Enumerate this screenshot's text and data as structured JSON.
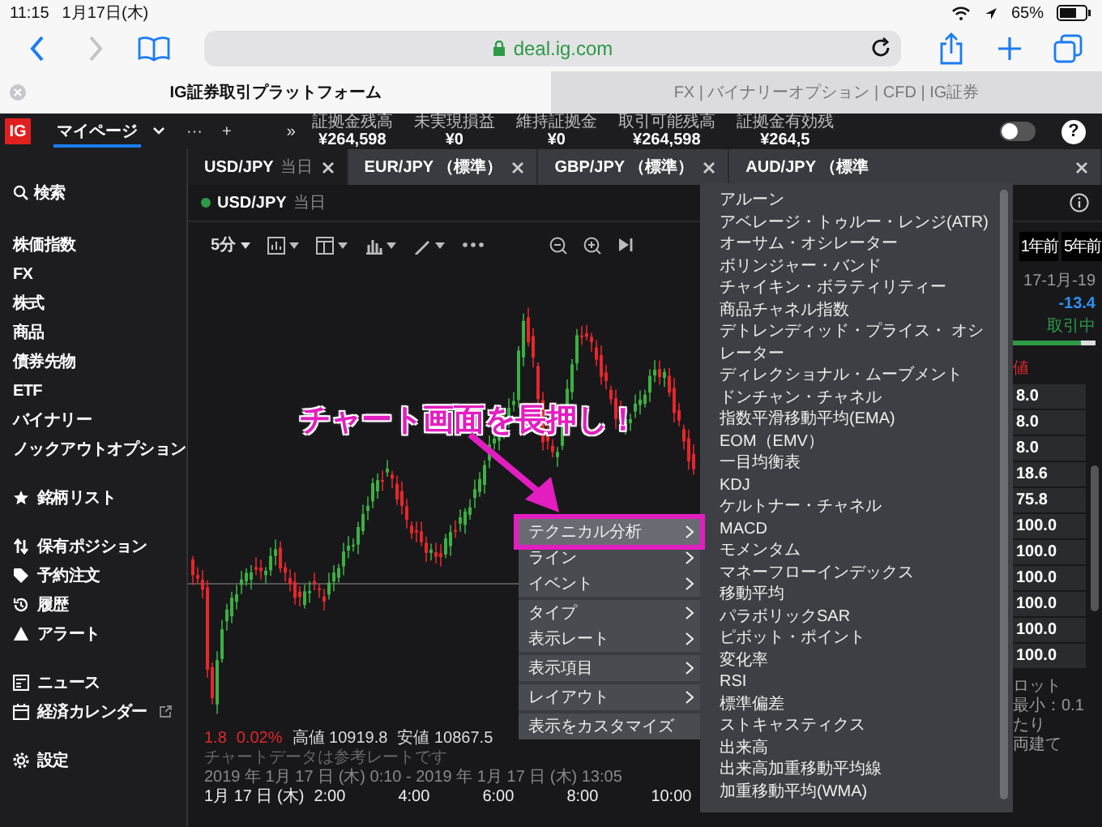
{
  "status_bar": {
    "time": "11:15",
    "date": "1月17日(木)",
    "battery": "65%"
  },
  "browser": {
    "url": "deal.ig.com",
    "tabs": [
      {
        "title": "IG証券取引プラットフォーム",
        "selected": true
      },
      {
        "title": "FX | バイナリーオプション | CFD | IG証券",
        "selected": false
      }
    ]
  },
  "app_header": {
    "logo": "IG",
    "page": "マイページ",
    "more": "···",
    "add": "+",
    "expand": "»",
    "stats": [
      {
        "label": "証拠金残高",
        "value": "¥264,598"
      },
      {
        "label": "未実現損益",
        "value": "¥0"
      },
      {
        "label": "維持証拠金",
        "value": "¥0"
      },
      {
        "label": "取引可能残高",
        "value": "¥264,598"
      },
      {
        "label": "証拠金有効残",
        "value": "¥264,5"
      }
    ],
    "toggle": {
      "on": false
    },
    "help": "?"
  },
  "sidebar": {
    "search": "検索",
    "groups": [
      [
        "株価指数",
        "FX",
        "株式",
        "商品",
        "債券先物",
        "ETF",
        "バイナリー",
        "ノックアウトオプション"
      ],
      [
        "銘柄リスト"
      ],
      [
        "保有ポジション",
        "予約注文",
        "履歴",
        "アラート"
      ],
      [
        "ニュース",
        "経済カレンダー"
      ],
      [
        "設定"
      ]
    ]
  },
  "market_tabs": [
    {
      "label": "USD/JPY",
      "period": "当日",
      "selected": true
    },
    {
      "label": "EUR/JPY （標準）",
      "selected": false
    },
    {
      "label": "GBP/JPY （標準）",
      "selected": false
    },
    {
      "label": "AUD/JPY （標準",
      "selected": false
    }
  ],
  "chart": {
    "title": "USD/JPY",
    "period": "当日",
    "open": true,
    "interval": "5分",
    "annotation": "チャート画面を長押し！",
    "change": "1.8",
    "change_pct": "0.02%",
    "high": "高値 10919.8",
    "low": "安値 10867.5",
    "range": "2019 年 1月 17 日 (木) 0:10 - 2019 年 1月 17 日 (木) 13:05",
    "note": "チャートデータは参考レートです",
    "x_labels": [
      "1月 17 日 (木)",
      "2:00",
      "4:00",
      "6:00",
      "8:00",
      "10:00"
    ]
  },
  "context_menu": {
    "groups": [
      [
        {
          "label": "テクニカル分析",
          "submenu": true,
          "selected": true
        },
        {
          "label": "ライン",
          "submenu": true,
          "selected": false
        },
        {
          "label": "イベント",
          "submenu": true,
          "selected": false
        }
      ],
      [
        {
          "label": "タイプ",
          "submenu": true,
          "selected": false
        },
        {
          "label": "表示レート",
          "submenu": true,
          "selected": false
        }
      ],
      [
        {
          "label": "表示項目",
          "submenu": true,
          "selected": false
        }
      ],
      [
        {
          "label": "レイアウト",
          "submenu": true,
          "selected": false
        }
      ],
      [
        {
          "label": "表示をカスタマイズ",
          "submenu": false,
          "selected": false
        }
      ]
    ]
  },
  "submenu": {
    "items": [
      "アルーン",
      "アベレージ・トゥルー・レンジ(ATR)",
      "オーサム・オシレーター",
      "ボリンジャー・バンド",
      "チャイキン・ボラティリティー",
      "商品チャネル指数",
      "デトレンディッド・プライス・ オシレーター",
      "ディレクショナル・ムーブメント",
      "ドンチャン・チャネル",
      "指数平滑移動平均(EMA)",
      "EOM（EMV）",
      "一目均衡表",
      "KDJ",
      "ケルトナー・チャネル",
      "MACD",
      "モメンタム",
      "マネーフローインデックス",
      "移動平均",
      "パラボリックSAR",
      "ピボット・ポイント",
      "変化率",
      "RSI",
      "標準偏差",
      "ストキャスティクス",
      "出来高",
      "出来高加重移動平均線",
      "加重移動平均(WMA)"
    ]
  },
  "right_panel": {
    "periods": [
      "1年前",
      "5年前"
    ],
    "date": "17-1月-19",
    "change": "-13.4",
    "status": "取引中",
    "level": 0.82,
    "price_label": "値",
    "values": [
      "8.0",
      "8.0",
      "8.0",
      "18.6",
      "75.8",
      "100.0",
      "100.0",
      "100.0",
      "100.0",
      "100.0",
      "100.0"
    ],
    "notes": [
      "ロット",
      "最小：0.1",
      "たり",
      "両建て"
    ]
  }
}
